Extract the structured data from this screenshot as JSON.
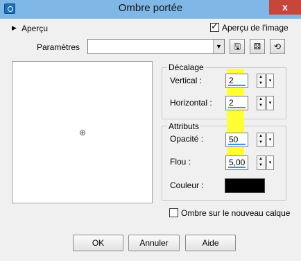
{
  "window": {
    "title": "Ombre portée",
    "close_glyph": "x"
  },
  "top": {
    "apercu_label": "Aperçu",
    "preview_checkbox_label": "Aperçu de l'image",
    "preview_checked": true,
    "params_label": "Paramètres",
    "params_value": ""
  },
  "offset_group": {
    "title": "Décalage",
    "vertical_label": "Vertical :",
    "vertical_value": "2",
    "horizontal_label": "Horizontal :",
    "horizontal_value": "2"
  },
  "attributes_group": {
    "title": "Attributs",
    "opacity_label": "Opacité :",
    "opacity_value": "50",
    "blur_label": "Flou :",
    "blur_value": "5,00",
    "color_label": "Couleur :",
    "color_value": "#000000"
  },
  "new_layer_label": "Ombre sur le nouveau calque",
  "new_layer_checked": false,
  "buttons": {
    "ok": "OK",
    "cancel": "Annuler",
    "help": "Aide"
  },
  "highlight_color": "#ffff33"
}
